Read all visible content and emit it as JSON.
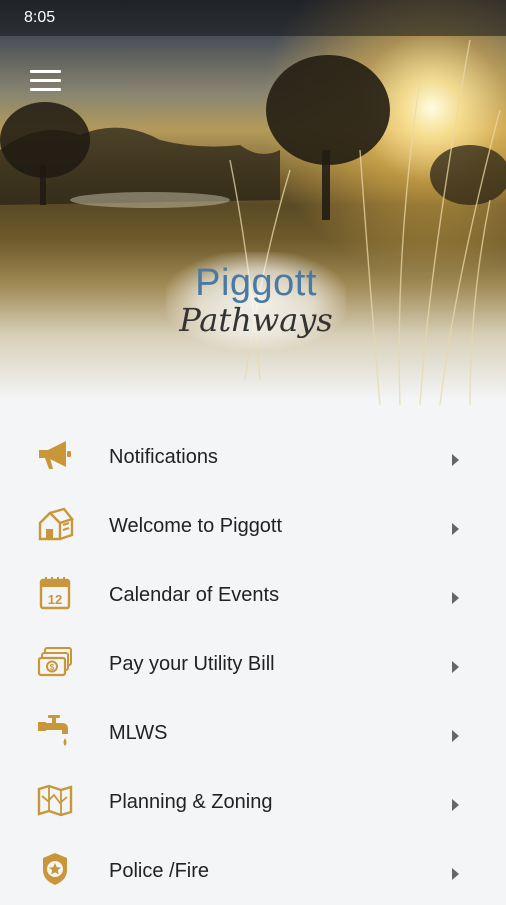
{
  "status_bar": {
    "time": "8:05"
  },
  "header": {
    "menu_icon": "hamburger-icon",
    "logo_line1": "Piggott",
    "logo_line2": "Pathways"
  },
  "colors": {
    "accent": "#c9963a",
    "logo_blue": "#4a7aa3",
    "background": "#f3f5f7"
  },
  "menu": [
    {
      "label": "Notifications",
      "icon": "megaphone-icon"
    },
    {
      "label": "Welcome to Piggott",
      "icon": "house-icon"
    },
    {
      "label": "Calendar of Events",
      "icon": "calendar-icon"
    },
    {
      "label": "Pay your Utility Bill",
      "icon": "money-icon"
    },
    {
      "label": "MLWS",
      "icon": "faucet-icon"
    },
    {
      "label": "Planning & Zoning",
      "icon": "map-icon"
    },
    {
      "label": "Police /Fire",
      "icon": "badge-icon"
    }
  ]
}
